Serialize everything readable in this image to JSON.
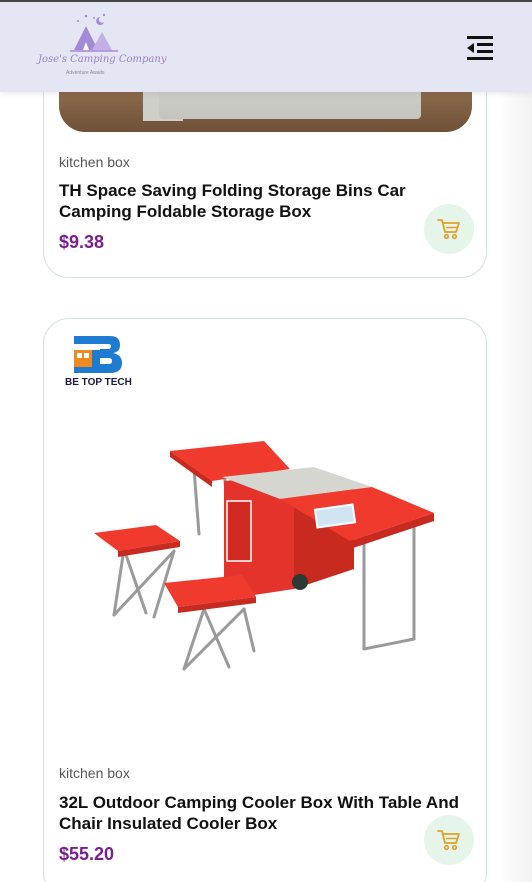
{
  "header": {
    "logo_text": "Jose's Camping Company",
    "logo_tagline": "Adventure Awaits"
  },
  "icons": {
    "menu": "menu-collapse-icon",
    "cart": "shopping-cart-icon",
    "logo": "campfire-tent-icon"
  },
  "colors": {
    "header_bg": "#e4e6f3",
    "price": "#7b1f8e",
    "cart_bg": "#e6f5e9",
    "cart_icon": "#e0a22a",
    "card_border": "#cfe3df"
  },
  "products": [
    {
      "category": "kitchen box",
      "title": "TH Space Saving Folding Storage Bins Car Camping Foldable Storage Box",
      "price": "$9.38"
    },
    {
      "category": "kitchen box",
      "brand": "BE TOP TECH",
      "title": "32L Outdoor Camping Cooler Box With Table And Chair Insulated Cooler Box",
      "price": "$55.20"
    }
  ]
}
